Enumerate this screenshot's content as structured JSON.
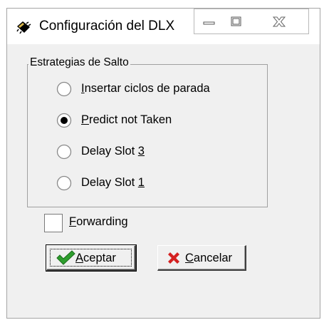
{
  "window": {
    "title": "Configuración del DLX",
    "icon": "chip-icon",
    "controls": [
      "minimize-icon",
      "maximize-icon",
      "close-icon"
    ]
  },
  "group": {
    "legend": "Estrategias de Salto",
    "options": [
      {
        "mnemonic": "I",
        "rest": "nsertar ciclos de parada",
        "selected": false
      },
      {
        "mnemonic": "P",
        "rest": "redict not Taken",
        "selected": true
      },
      {
        "prefix": "Delay Slot ",
        "mnemonic": "3",
        "selected": false
      },
      {
        "prefix": "Delay Slot ",
        "mnemonic": "1",
        "selected": false
      }
    ]
  },
  "forwarding": {
    "mnemonic": "F",
    "rest": "orwarding",
    "checked": false
  },
  "buttons": {
    "ok": {
      "mnemonic": "A",
      "rest": "ceptar",
      "icon": "checkmark-icon"
    },
    "cancel": {
      "mnemonic": "C",
      "rest": "ancelar",
      "icon": "red-x-icon"
    }
  },
  "colors": {
    "check_green": "#2e9e2e",
    "cancel_red": "#d42020",
    "face": "#f0f0f0"
  }
}
